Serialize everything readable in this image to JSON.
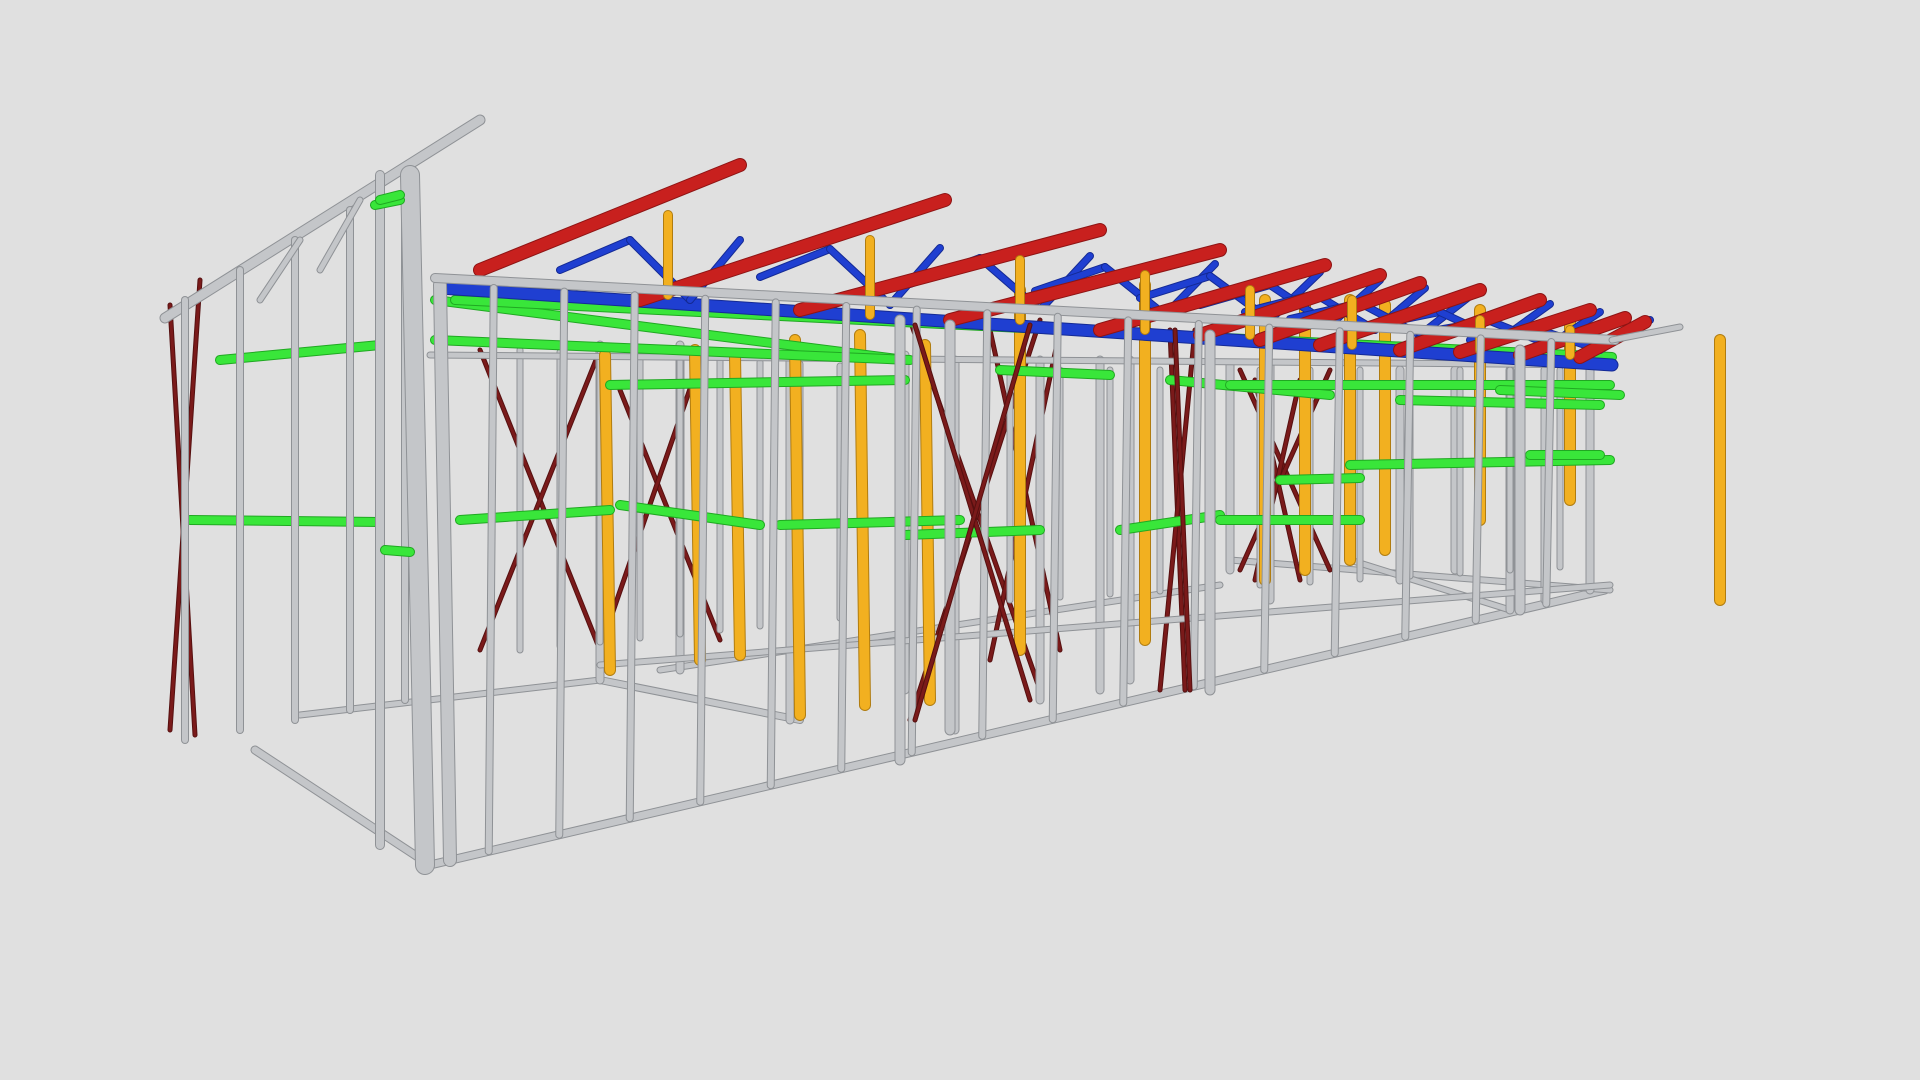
{
  "viewer": {
    "background": "#e0e0e0"
  },
  "model": {
    "member_types": [
      {
        "name": "wall-frame",
        "color": "#c4c6c9",
        "edge": "#8f9296"
      },
      {
        "name": "roof-truss-chord",
        "color": "#c8201e",
        "edge": "#8e1414"
      },
      {
        "name": "truss-web",
        "color": "#1f3fd1",
        "edge": "#142a95"
      },
      {
        "name": "nogging",
        "color": "#39e63a",
        "edge": "#20a822"
      },
      {
        "name": "post",
        "color": "#f2b020",
        "edge": "#b07c10"
      },
      {
        "name": "bracing",
        "color": "#7a1a1a",
        "edge": "#561010"
      }
    ]
  }
}
